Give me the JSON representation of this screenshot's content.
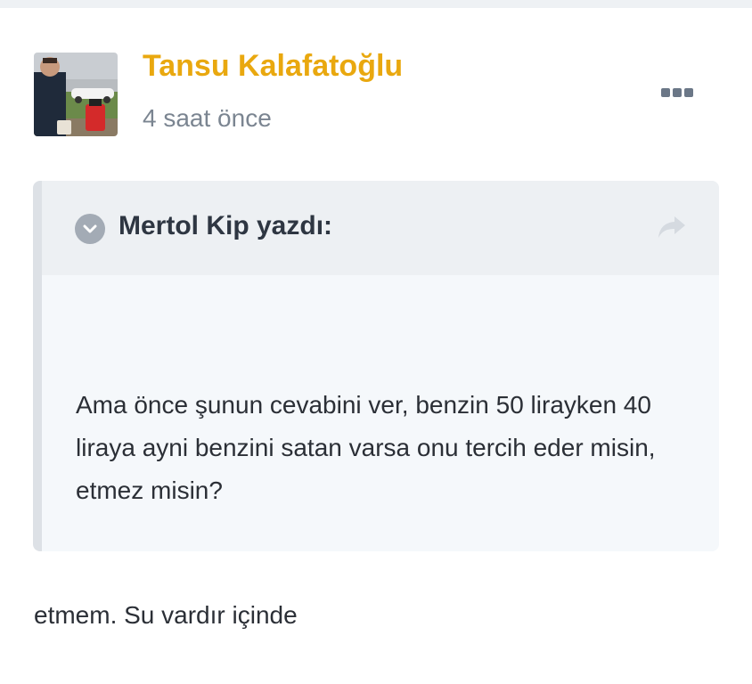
{
  "post": {
    "author": "Tansu Kalafatoğlu",
    "time": "4 saat önce",
    "avatar_alt": "Tansu Kalafatoğlu",
    "more_icon": "ellipsis-icon"
  },
  "quote": {
    "author": "Mertol Kip yazdı:",
    "expand_icon": "chevron-down-circle-icon",
    "goto_icon": "share-arrow-icon",
    "text": "Ama önce şunun cevabini ver, benzin 50 lirayken 40 liraya ayni benzini satan varsa onu tercih eder misin, etmez misin?"
  },
  "reply": {
    "text": "etmem. Su vardır içinde"
  },
  "colors": {
    "author_name": "#e9a80f",
    "meta_text": "#7b8591",
    "quote_header_bg": "#edf0f3",
    "quote_body_bg": "#f5f8fb",
    "quote_border": "#dde1e6"
  }
}
